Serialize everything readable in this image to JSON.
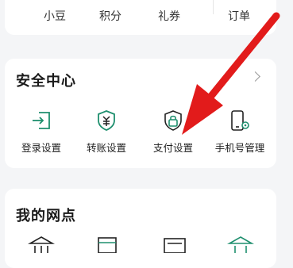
{
  "top_bar": {
    "items": [
      {
        "label": "小豆"
      },
      {
        "label": "积分"
      },
      {
        "label": "礼券"
      },
      {
        "label": "订单"
      }
    ]
  },
  "security_center": {
    "title": "安全中心",
    "items": [
      {
        "label": "登录设置",
        "icon": "login-icon"
      },
      {
        "label": "转账设置",
        "icon": "shield-yen-icon"
      },
      {
        "label": "支付设置",
        "icon": "lock-shield-icon"
      },
      {
        "label": "手机号管理",
        "icon": "phone-gear-icon"
      }
    ]
  },
  "my_outlets": {
    "title": "我的网点",
    "icons": [
      "bank-icon",
      "id-card-icon",
      "atm-icon",
      "building-icon"
    ]
  },
  "colors": {
    "accent": "#1e8f6e",
    "arrow": "#e21b1b"
  }
}
